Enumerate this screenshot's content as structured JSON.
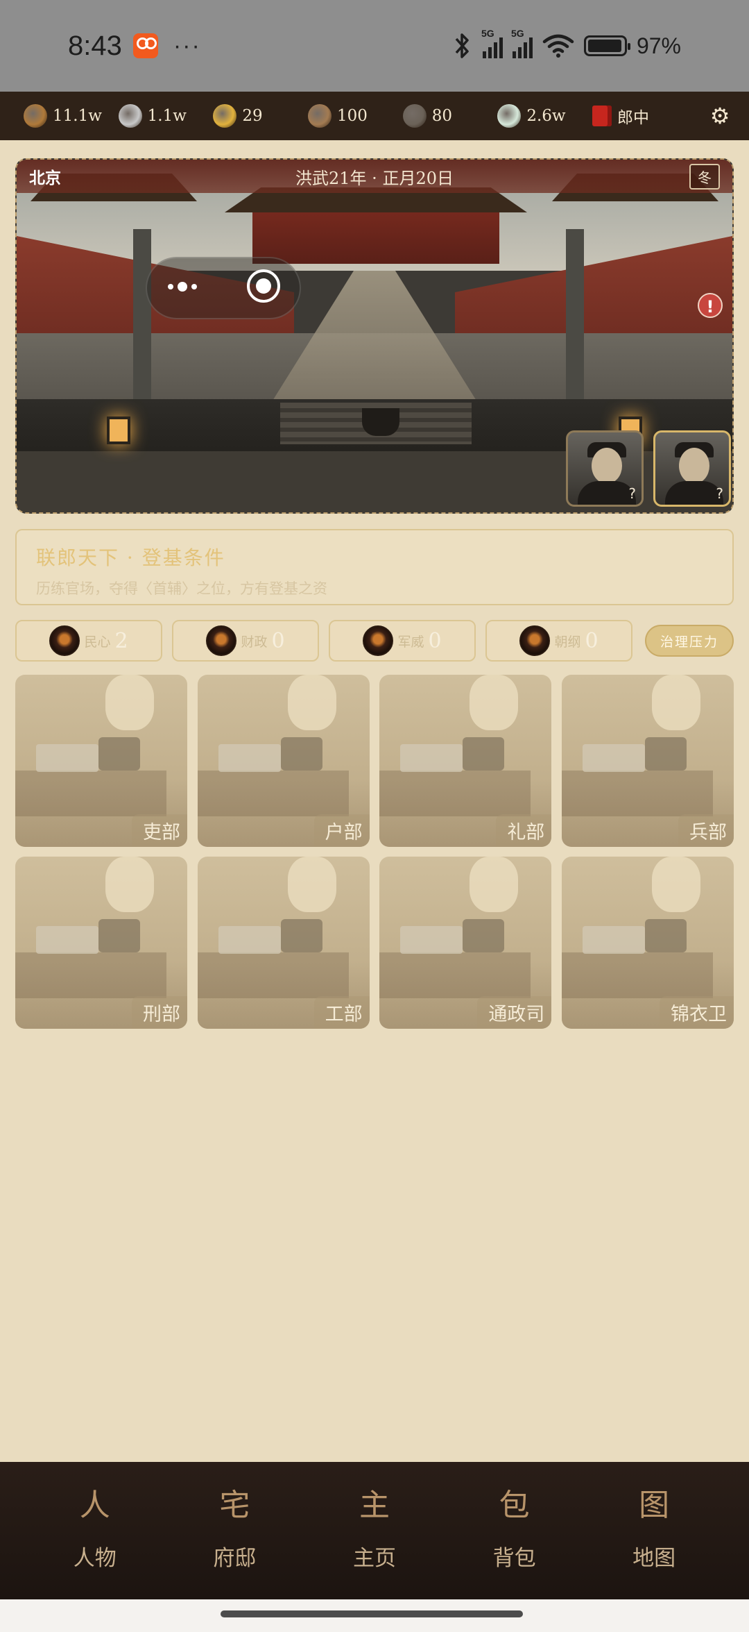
{
  "status_bar": {
    "time": "8:43",
    "more": "···",
    "signal1_label": "5G",
    "signal2_label": "5G",
    "battery_pct": "97%",
    "battery_level": 0.97
  },
  "resources": {
    "items": [
      {
        "icon": "copper-coin-icon",
        "value": "11.1w",
        "color": "#b07a3a"
      },
      {
        "icon": "silver-ingot-icon",
        "value": "1.1w",
        "color": "#c8c8c8"
      },
      {
        "icon": "gold-ingot-icon",
        "value": "29",
        "color": "#e2b23d"
      },
      {
        "icon": "grain-sack-icon",
        "value": "100",
        "color": "#a37b52"
      },
      {
        "icon": "iron-ore-icon",
        "value": "80",
        "color": "#6b6258"
      },
      {
        "icon": "jade-icon",
        "value": "2.6w",
        "color": "#d6e8da"
      }
    ],
    "rank": "郎中",
    "settings_icon": "gear-icon"
  },
  "scene": {
    "location": "北京",
    "date": "洪武21年 · 正月20日",
    "season": "冬",
    "portrait_1_mark": "?",
    "portrait_2_mark": "?",
    "alert_mark": "!"
  },
  "goal": {
    "title": "联郎天下 · 登基条件",
    "subtitle": "历练官场，夺得〈首辅〉之位，方有登基之资"
  },
  "stats": {
    "items": [
      {
        "label": "民心",
        "value": "2"
      },
      {
        "label": "财政",
        "value": "0"
      },
      {
        "label": "军威",
        "value": "0"
      },
      {
        "label": "朝纲",
        "value": "0"
      }
    ],
    "pressure_button": "治理压力"
  },
  "ministries": [
    {
      "label": "吏部"
    },
    {
      "label": "户部"
    },
    {
      "label": "礼部"
    },
    {
      "label": "兵部"
    },
    {
      "label": "刑部"
    },
    {
      "label": "工部"
    },
    {
      "label": "通政司"
    },
    {
      "label": "锦衣卫"
    }
  ],
  "nav": [
    {
      "glyph": "人",
      "label": "人物"
    },
    {
      "glyph": "宅",
      "label": "府邸"
    },
    {
      "glyph": "主",
      "label": "主页"
    },
    {
      "glyph": "包",
      "label": "背包"
    },
    {
      "glyph": "图",
      "label": "地图"
    }
  ]
}
